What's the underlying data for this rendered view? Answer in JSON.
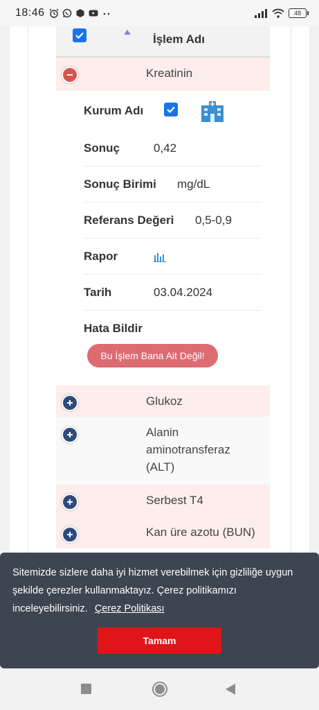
{
  "status_bar": {
    "time": "18:46",
    "battery": "48",
    "left_icons": [
      "alarm-icon",
      "whatsapp-icon",
      "cube-icon",
      "youtube-icon",
      "more-dots-icon"
    ],
    "right_icons": [
      "signal-icon",
      "wifi-icon",
      "battery-icon"
    ]
  },
  "table": {
    "header_label": "İşlem Adı",
    "rows": [
      {
        "name": "Kreatinin",
        "expanded": true
      },
      {
        "name": "Glukoz",
        "expanded": false
      },
      {
        "name": "Alanin aminotransferaz (ALT)",
        "expanded": false
      },
      {
        "name": "Serbest T4",
        "expanded": false
      },
      {
        "name": "Kan üre azotu (BUN)",
        "expanded": false
      }
    ],
    "detail": {
      "kurum_label": "Kurum Adı",
      "kurum_icon": "hospital-icon",
      "sonuc_label": "Sonuç",
      "sonuc_value": "0,42",
      "birim_label": "Sonuç Birimi",
      "birim_value": "mg/dL",
      "referans_label": "Referans Değeri",
      "referans_value": "0,5-0,9",
      "rapor_label": "Rapor",
      "rapor_icon": "bar-chart-icon",
      "tarih_label": "Tarih",
      "tarih_value": "03.04.2024",
      "hata_label": "Hata Bildir",
      "report_button": "Bu İşlem Bana Ait Değil!"
    }
  },
  "cookie_banner": {
    "message": "Sitemizde sizlere daha iyi hizmet verebilmek için gizliliğe uygun şekilde çerezler kullanmaktayız. Çerez politikamızı inceleyebilirsiniz.",
    "policy_link": "Çerez Politikası",
    "accept_button": "Tamam"
  },
  "colors": {
    "row_highlight": "#fdeded",
    "checkbox": "#1a73e8",
    "minus_toggle": "#d9534f",
    "plus_toggle": "#2e4a7d",
    "report_button": "#dc6b72",
    "cookie_bg": "#3c4550",
    "accept_button": "#e0151a"
  }
}
